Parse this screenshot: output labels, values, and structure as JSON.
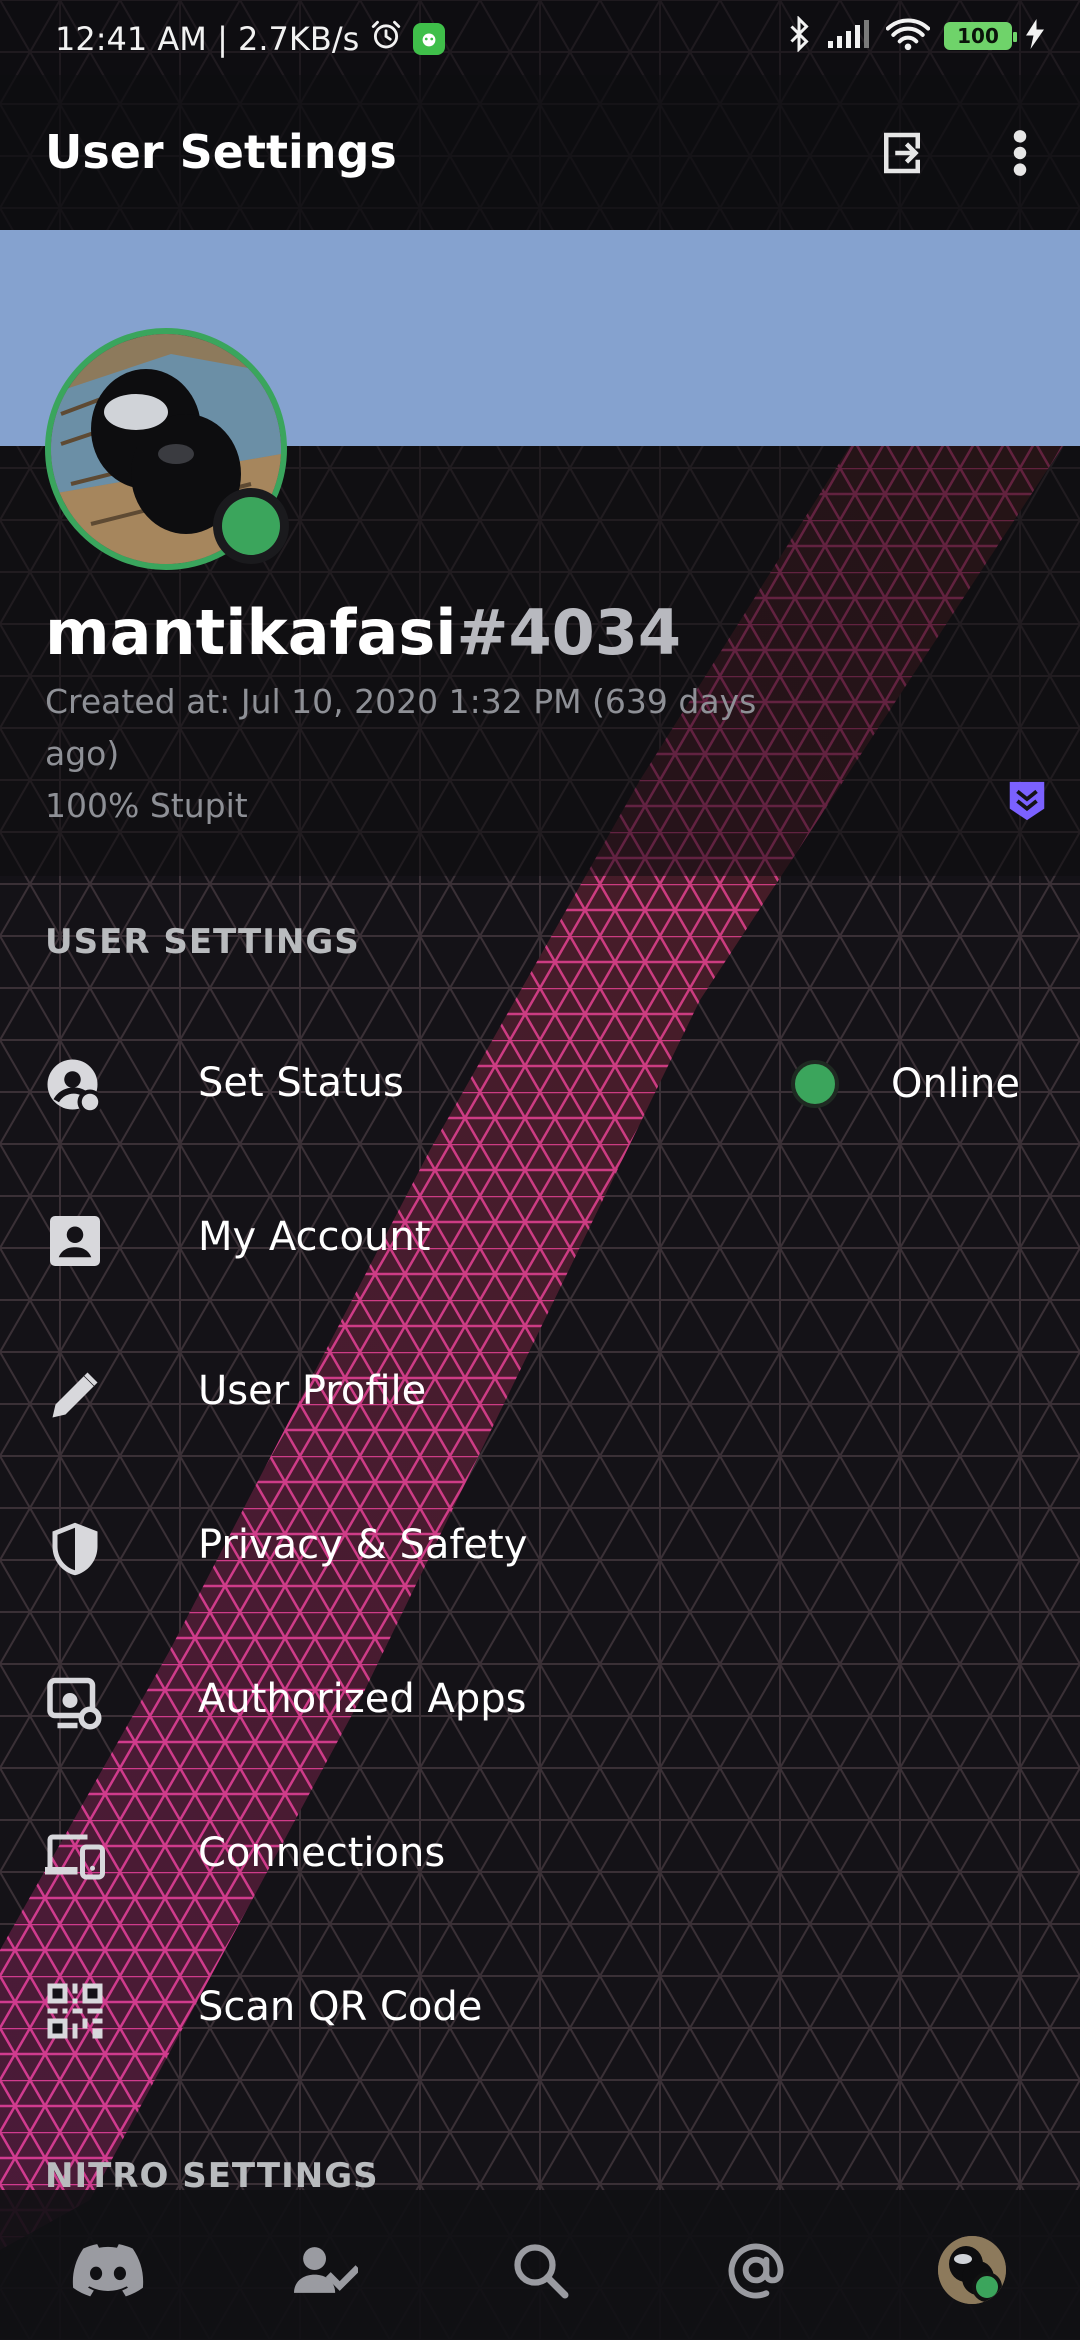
{
  "status_bar": {
    "time_speed": "12:41 AM | 2.7KB/s",
    "battery": "100"
  },
  "header": {
    "title": "User Settings",
    "icons": [
      "logout-icon",
      "more-vertical-icon"
    ]
  },
  "profile": {
    "username": "mantikafasi",
    "discriminator": "#4034",
    "created_at": "Created at: Jul 10, 2020 1:32 PM (639 days ago)",
    "about": "100% Stupit"
  },
  "user_settings": {
    "section_title": "USER SETTINGS",
    "status_value": "Online",
    "items": [
      {
        "label": "Set Status",
        "icon": "status-icon"
      },
      {
        "label": "My Account",
        "icon": "account-icon"
      },
      {
        "label": "User Profile",
        "icon": "pencil-icon"
      },
      {
        "label": "Privacy & Safety",
        "icon": "shield-icon"
      },
      {
        "label": "Authorized Apps",
        "icon": "authorized-apps-icon"
      },
      {
        "label": "Connections",
        "icon": "devices-icon"
      },
      {
        "label": "Scan QR Code",
        "icon": "qr-code-icon"
      }
    ]
  },
  "nitro_settings": {
    "section_title": "NITRO SETTINGS"
  },
  "bottom_nav": [
    "discord-home-icon",
    "friends-icon",
    "search-icon",
    "mentions-icon",
    "profile-avatar"
  ],
  "colors": {
    "banner": "#85a2cf",
    "online": "#3ba55c",
    "accent_purple": "#7b61ff",
    "pattern_pink": "#d23c8e",
    "pattern_red": "#c84b3a"
  }
}
